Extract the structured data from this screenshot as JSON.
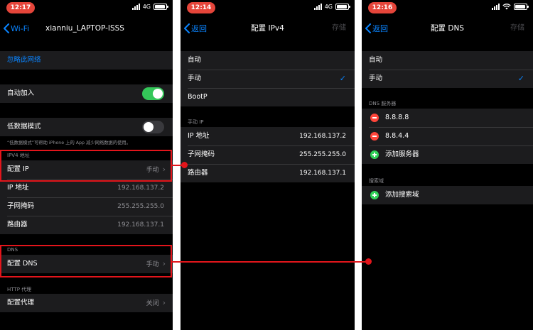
{
  "screens": {
    "wifi": {
      "time": "12:17",
      "network": "4G",
      "back_label": "Wi-Fi",
      "title": "xianniu_LAPTOP-ISSS",
      "forget_label": "忽略此网络",
      "auto_join_label": "自动加入",
      "auto_join_on": true,
      "low_data_label": "低数据模式",
      "low_data_on": false,
      "low_data_note": "“低数据模式”可帮助 iPhone 上的 App 减少网络数据的使用。",
      "ipv4_header": "IPV4 地址",
      "config_ip_label": "配置 IP",
      "config_ip_value": "手动",
      "ip_label": "IP 地址",
      "ip_value": "192.168.137.2",
      "subnet_label": "子网掩码",
      "subnet_value": "255.255.255.0",
      "router_label": "路由器",
      "router_value": "192.168.137.1",
      "dns_header": "DNS",
      "config_dns_label": "配置 DNS",
      "config_dns_value": "手动",
      "proxy_header": "HTTP 代理",
      "config_proxy_label": "配置代理",
      "config_proxy_value": "关闭"
    },
    "ipv4": {
      "time": "12:14",
      "network": "4G",
      "back_label": "返回",
      "title": "配置 IPv4",
      "save_label": "存储",
      "options": [
        "自动",
        "手动",
        "BootP"
      ],
      "selected_option": "手动",
      "manual_header": "手动 IP",
      "ip_label": "IP 地址",
      "ip_value": "192.168.137.2",
      "subnet_label": "子网掩码",
      "subnet_value": "255.255.255.0",
      "router_label": "路由器",
      "router_value": "192.168.137.1"
    },
    "dns": {
      "time": "12:16",
      "back_label": "返回",
      "title": "配置 DNS",
      "save_label": "存储",
      "options": [
        "自动",
        "手动"
      ],
      "selected_option": "手动",
      "servers_header": "DNS 服务器",
      "servers": [
        "8.8.8.8",
        "8.8.4.4"
      ],
      "add_server_label": "添加服务器",
      "search_header": "搜索域",
      "add_search_label": "添加搜索域"
    }
  },
  "colors": {
    "background": "#000000",
    "cell": "#1c1c1e",
    "accent": "#0a84ff",
    "toggle_on": "#34c759",
    "highlight": "#e3151b",
    "time_pill": "#e5453a"
  },
  "battery_level": 0.8
}
